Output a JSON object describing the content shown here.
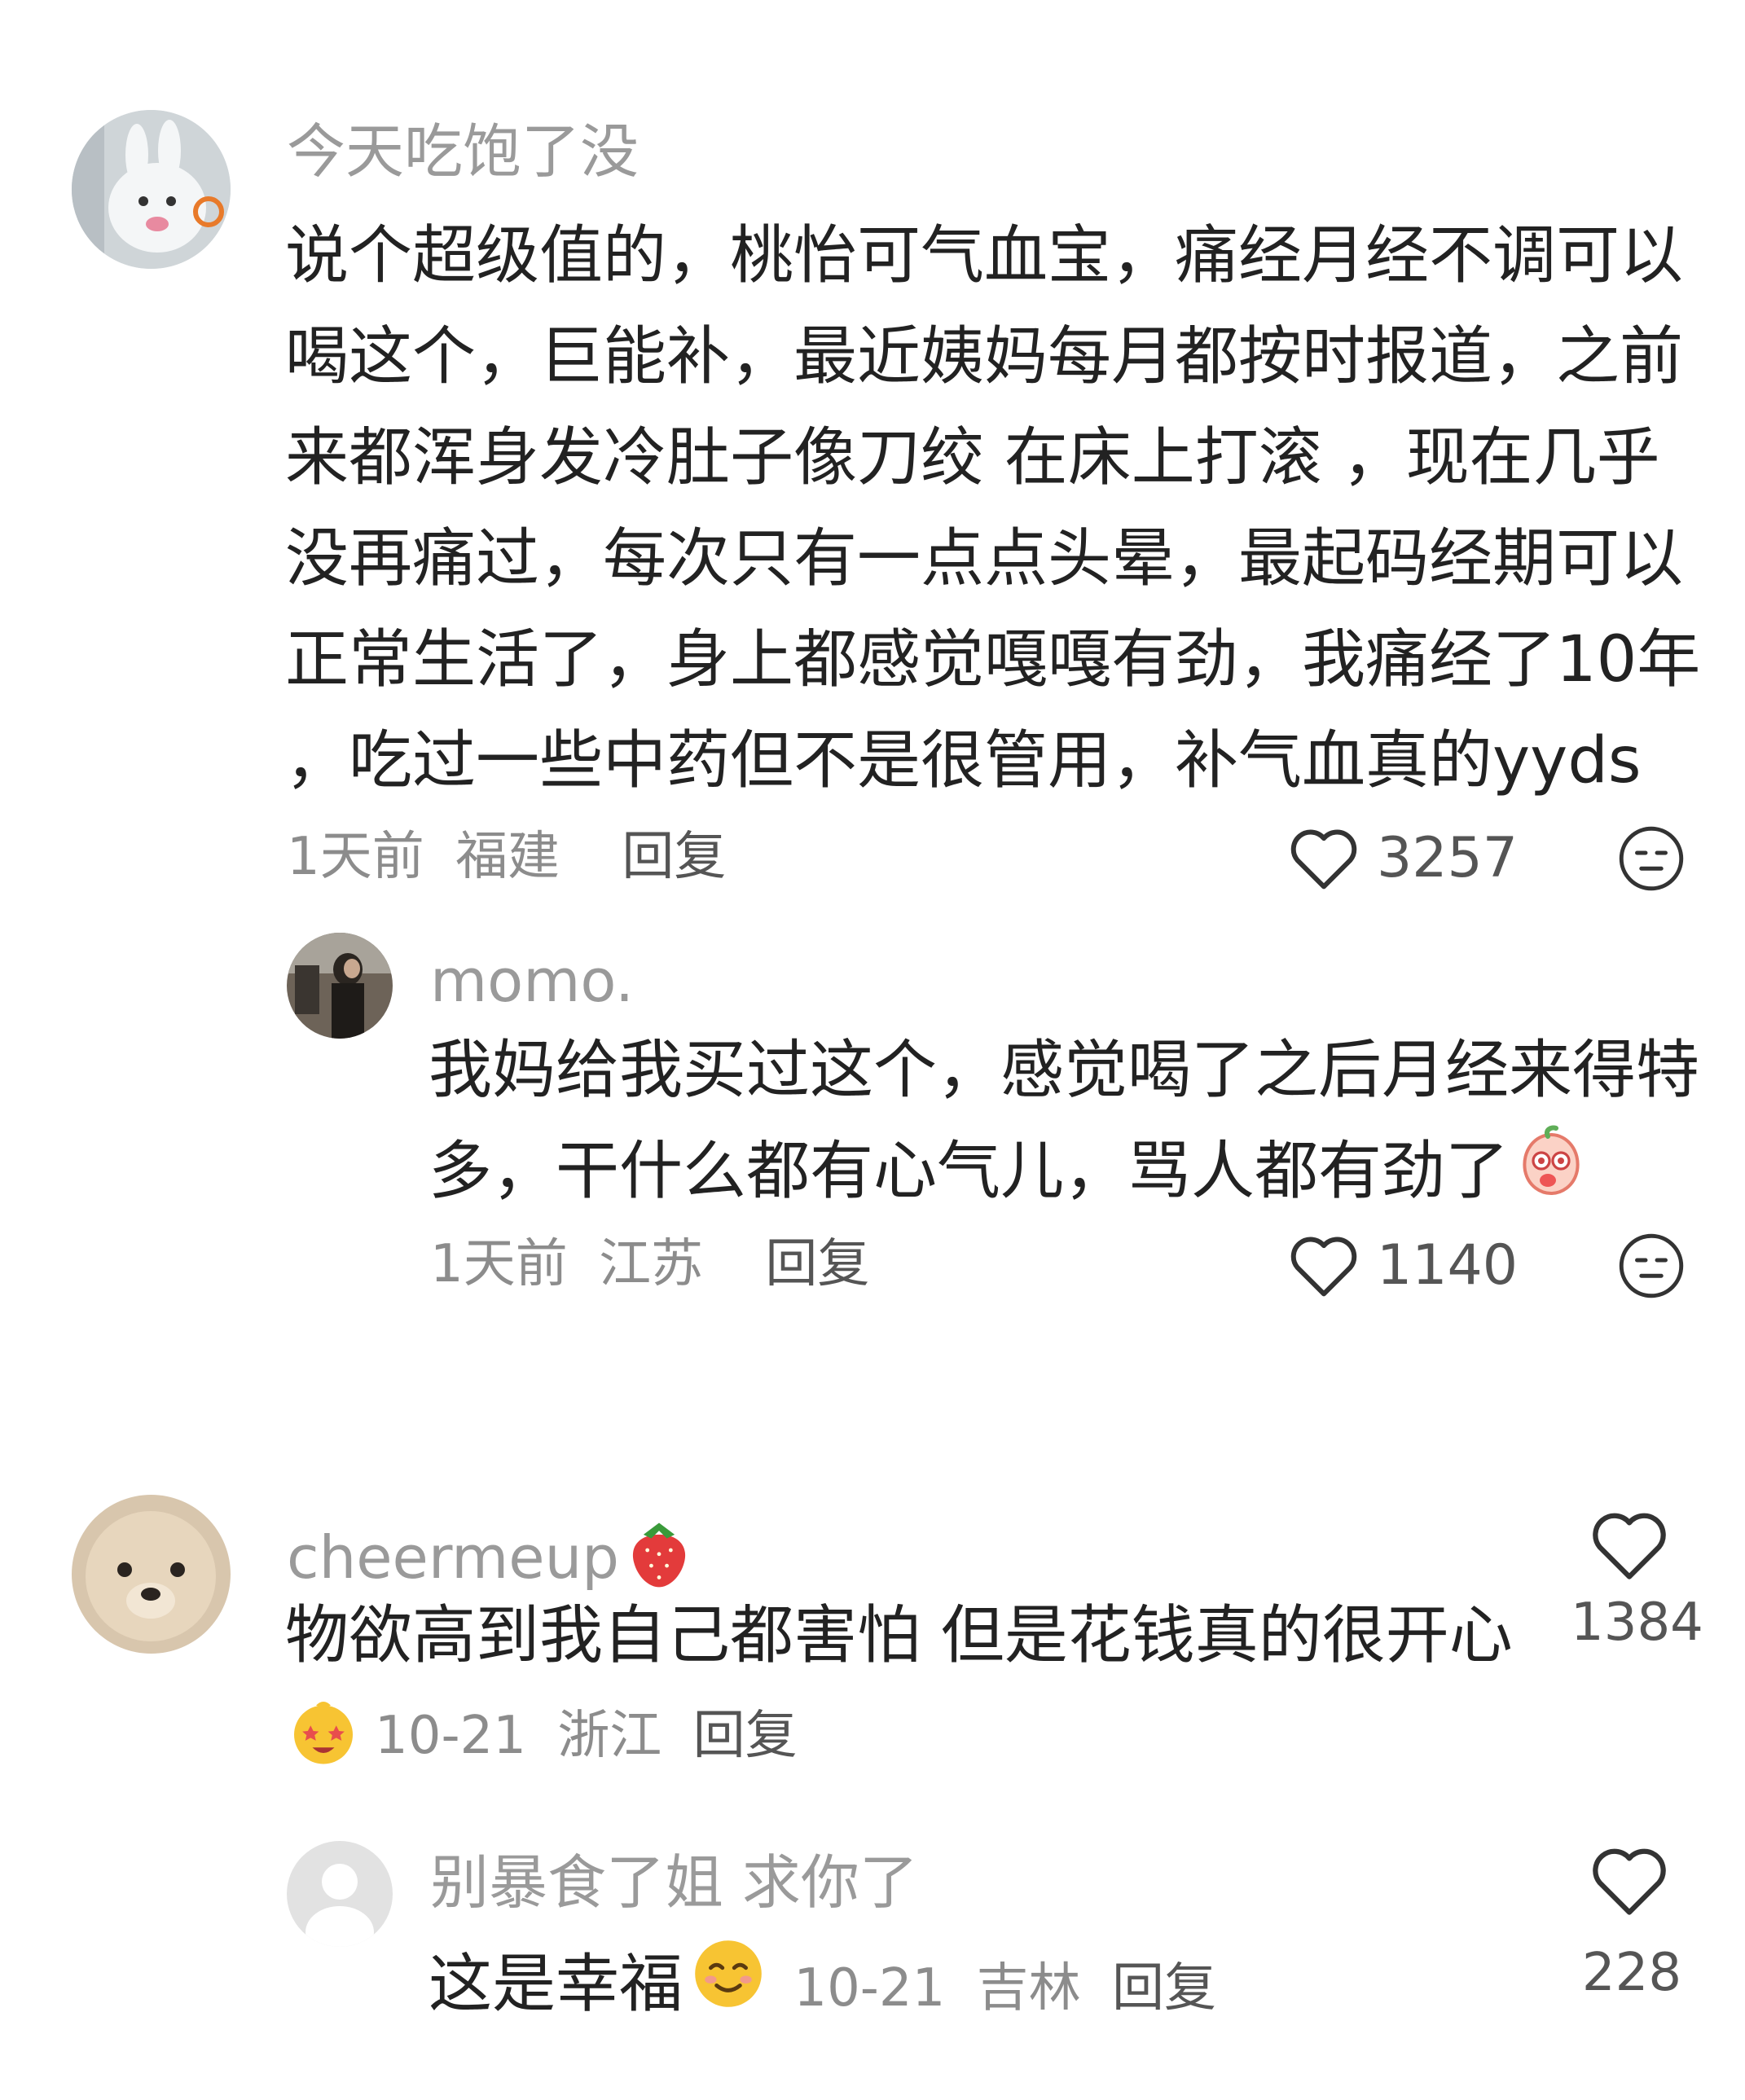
{
  "comments": [
    {
      "username": "今天吃饱了没",
      "text_lines": [
        "说个超级值的，桃怡可气血宝，痛经月经不调可以",
        "喝这个，巨能补，最近姨妈每月都按时报道，之前",
        "来都浑身发冷肚子像刀绞 在床上打滚 ，现在几乎",
        "没再痛过，每次只有一点点头晕，最起码经期可以",
        "正常生活了，身上都感觉嘎嘎有劲，我痛经了10年",
        "，吃过一些中药但不是很管用，补气血真的yyds"
      ],
      "time": "1天前",
      "location": "福建",
      "reply_label": "回复",
      "likes": "3257",
      "reply": {
        "username": "momo.",
        "text_lines": [
          "我妈给我买过这个，感觉喝了之后月经来得特",
          "多，干什么都有心气儿，骂人都有劲了"
        ],
        "time": "1天前",
        "location": "江苏",
        "reply_label": "回复",
        "likes": "1140"
      }
    },
    {
      "username": "cheermeup",
      "text": "物欲高到我自己都害怕 但是花钱真的很开心",
      "time": "10-21",
      "location": "浙江",
      "reply_label": "回复",
      "likes": "1384",
      "reply": {
        "username": "别暴食了姐 求你了",
        "text": "这是幸福",
        "time": "10-21",
        "location": "吉林",
        "reply_label": "回复",
        "likes": "228"
      }
    }
  ],
  "icons": {
    "like": "heart-outline-icon",
    "dislike": "meh-face-icon",
    "strawberry_badge": "strawberry-icon",
    "emoji_peach": "peach-emoji-icon",
    "emoji_star_eyes": "star-eyes-emoji-icon",
    "emoji_smile": "smiling-face-emoji-icon"
  },
  "colors": {
    "username": "#9a9a9a",
    "text": "#222222",
    "meta": "#8c8c8c",
    "icon": "#333333"
  }
}
